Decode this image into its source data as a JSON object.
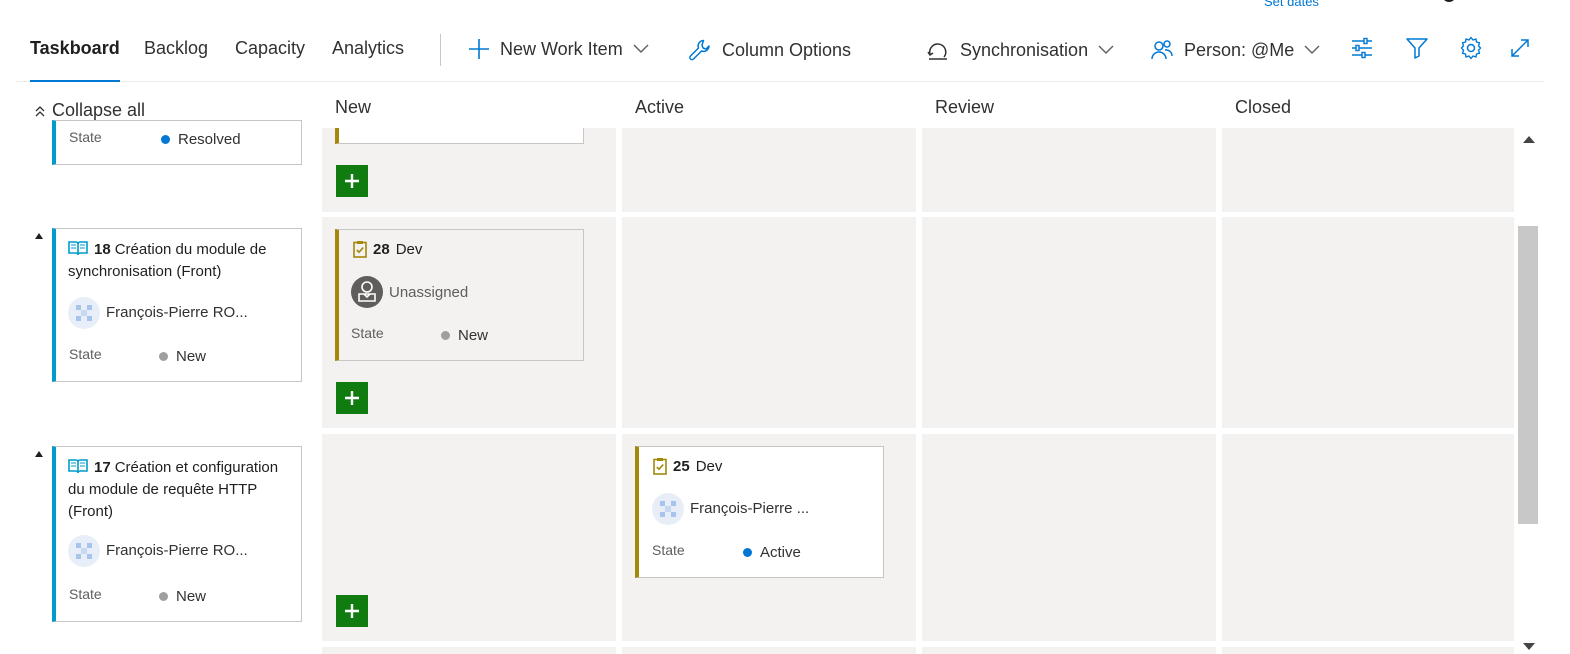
{
  "header_link": {
    "set_dates": "Set dates"
  },
  "tabs": [
    {
      "label": "Taskboard",
      "selected": true
    },
    {
      "label": "Backlog",
      "selected": false
    },
    {
      "label": "Capacity",
      "selected": false
    },
    {
      "label": "Analytics",
      "selected": false
    }
  ],
  "toolbar": {
    "new_work_item": "New Work Item",
    "column_options": "Column Options",
    "sprint": "Synchronisation",
    "person_filter": "Person: @Me"
  },
  "board": {
    "collapse_all": "Collapse all",
    "columns": [
      "New",
      "Active",
      "Review",
      "Closed"
    ],
    "state_label": "State"
  },
  "rows": [
    {
      "parent": {
        "state": "Resolved",
        "state_color": "#0078d4"
      }
    },
    {
      "parent": {
        "id": "18",
        "title": "Création du module de synchronisation (Front)",
        "assignee": "François-Pierre RO...",
        "state": "New",
        "state_color": "#a19f9d"
      },
      "task": {
        "id": "28",
        "title": "Dev",
        "assignee": "Unassigned",
        "state": "New",
        "state_color": "#a19f9d"
      }
    },
    {
      "parent": {
        "id": "17",
        "title": "Création et configuration du module de requête HTTP (Front)",
        "assignee": "François-Pierre RO...",
        "state": "New",
        "state_color": "#a19f9d"
      },
      "task": {
        "id": "25",
        "title": "Dev",
        "assignee": "François-Pierre ...",
        "state": "Active",
        "state_color": "#0078d4"
      }
    }
  ],
  "colors": {
    "accent": "#0078d4",
    "story_bar": "#009ccc",
    "task_bar": "#a4880a",
    "add_button": "#107c10"
  }
}
